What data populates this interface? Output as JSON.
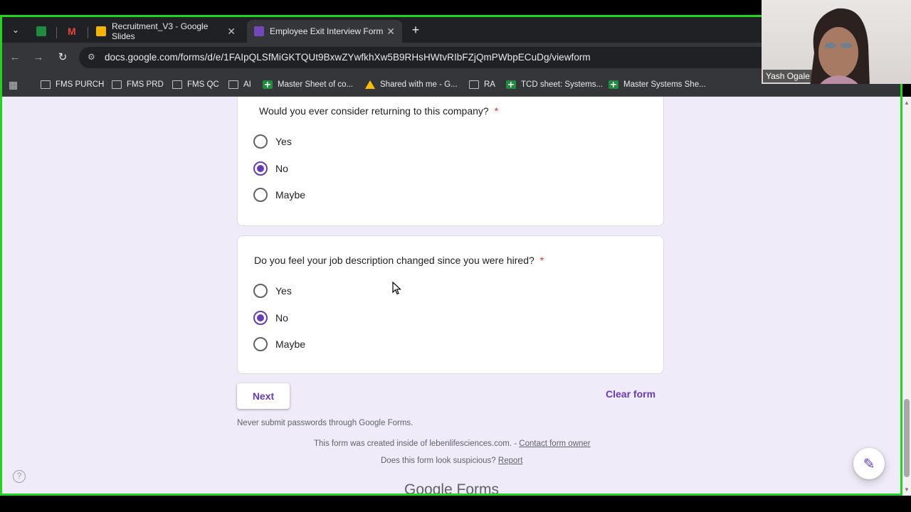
{
  "browser": {
    "tabs": [
      {
        "label": "",
        "icon": "sheets-icon"
      },
      {
        "label": "",
        "icon": "gmail-icon"
      },
      {
        "label": "Recruitment_V3 - Google Slides",
        "icon": "slides-icon"
      },
      {
        "label": "Employee Exit Interview Form",
        "icon": "forms-icon",
        "active": true
      }
    ],
    "url": "docs.google.com/forms/d/e/1FAIpQLSfMiGKTQUt9BxwZYwfkhXw5B9RHsHWtvRIbFZjQmPWbpECuDg/viewform",
    "bookmarks": [
      {
        "label": "FMS PURCH",
        "icon": "folder-icon"
      },
      {
        "label": "FMS PRD",
        "icon": "folder-icon"
      },
      {
        "label": "FMS QC",
        "icon": "folder-icon"
      },
      {
        "label": "AI",
        "icon": "folder-icon"
      },
      {
        "label": "Master Sheet of co...",
        "icon": "sheets-icon"
      },
      {
        "label": "Shared with me - G...",
        "icon": "drive-icon"
      },
      {
        "label": "RA",
        "icon": "folder-icon"
      },
      {
        "label": "TCD sheet: Systems...",
        "icon": "sheets-icon"
      },
      {
        "label": "Master Systems She...",
        "icon": "sheets-icon"
      }
    ]
  },
  "form": {
    "questions": [
      {
        "title": "Would you ever consider returning to this company?",
        "required": "*",
        "options": [
          "Yes",
          "No",
          "Maybe"
        ],
        "selected": "No"
      },
      {
        "title": "Do you feel your job description changed since you were hired?",
        "required": "*",
        "options": [
          "Yes",
          "No",
          "Maybe"
        ],
        "selected": "No"
      }
    ],
    "next_label": "Next",
    "clear_label": "Clear form",
    "footer": {
      "password_warning": "Never submit passwords through Google Forms.",
      "created_inside": "This form was created inside of lebenlifesciences.com. -",
      "contact_owner": "Contact form owner",
      "suspicious": "Does this form look suspicious?",
      "report": "Report",
      "logo": "Google Forms"
    }
  },
  "webcam": {
    "name": "Yash Ogale"
  },
  "colors": {
    "accent": "#673ab7",
    "page_bg": "#f0ebf8",
    "share_border": "#1fd61f"
  }
}
